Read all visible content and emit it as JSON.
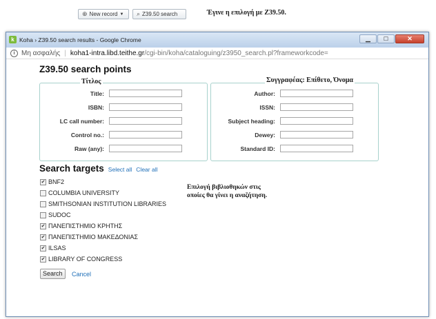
{
  "toolbar": {
    "new_record_label": "New record",
    "z3950_label": "Z39.50 search"
  },
  "annotations": {
    "selected": "Έγινε η επιλογή με Z39.50.",
    "author_fields": "Συγγραφέας: Επίθετο, Όνομα",
    "title_group": "Τίτλος",
    "library_choice_line1": "Επιλογή βιβλιοθηκών στις",
    "library_choice_line2": "οποίες θα γίνει η αναζήτηση."
  },
  "window": {
    "title": "Koha › Z39.50 search results - Google Chrome",
    "security_label": "Μη ασφαλής",
    "url_host": "koha1-intra.libd.teithe.gr",
    "url_path": "/cgi-bin/koha/cataloguing/z3950_search.pl?frameworkcode="
  },
  "form": {
    "heading": "Z39.50 search points",
    "left_fields": [
      {
        "label": "Title:",
        "value": ""
      },
      {
        "label": "ISBN:",
        "value": ""
      },
      {
        "label": "LC call number:",
        "value": ""
      },
      {
        "label": "Control no.:",
        "value": ""
      },
      {
        "label": "Raw (any):",
        "value": ""
      }
    ],
    "right_fields": [
      {
        "label": "Author:",
        "value": ""
      },
      {
        "label": "ISSN:",
        "value": ""
      },
      {
        "label": "Subject heading:",
        "value": ""
      },
      {
        "label": "Dewey:",
        "value": ""
      },
      {
        "label": "Standard ID:",
        "value": ""
      }
    ]
  },
  "targets": {
    "heading": "Search targets",
    "select_all": "Select all",
    "clear_all": "Clear all",
    "items": [
      {
        "label": "BNF2",
        "checked": true
      },
      {
        "label": "COLUMBIA UNIVERSITY",
        "checked": false
      },
      {
        "label": "SMITHSONIAN INSTITUTION LIBRARIES",
        "checked": false
      },
      {
        "label": "SUDOC",
        "checked": false
      },
      {
        "label": "ΠΑΝΕΠΙΣΤΗΜΙΟ ΚΡΗΤΗΣ",
        "checked": true
      },
      {
        "label": "ΠΑΝΕΠΙΣΤΗΜΙΟ ΜΑΚΕΔΟΝΙΑΣ",
        "checked": true
      },
      {
        "label": "ILSAS",
        "checked": true
      },
      {
        "label": "LIBRARY OF CONGRESS",
        "checked": true
      }
    ]
  },
  "actions": {
    "search_label": "Search",
    "cancel_label": "Cancel"
  }
}
